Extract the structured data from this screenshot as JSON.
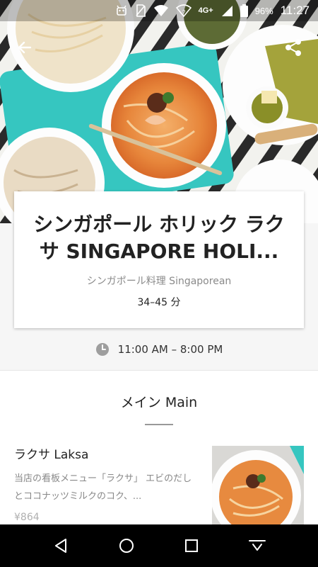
{
  "status_bar": {
    "network": "4G+",
    "battery": "96%",
    "time": "11:27"
  },
  "restaurant": {
    "title": "シンガポール ホリック ラクサ SINGAPORE HOLI...",
    "cuisine": "シンガポール料理 Singaporean",
    "delivery_time": "34–45 分",
    "hours": "11:00 AM – 8:00 PM"
  },
  "menu": {
    "section_title": "メイン Main",
    "items": [
      {
        "name": "ラクサ Laksa",
        "description": "当店の看板メニュー「ラクサ」 エビのだしとココナッツミルクのコク、...",
        "price": "¥864"
      }
    ]
  },
  "icons": [
    "back-arrow-icon",
    "share-icon",
    "clock-icon",
    "nav-back-icon",
    "nav-home-icon",
    "nav-recents-icon",
    "nav-keyboard-icon"
  ],
  "colors": {
    "accent_teal": "#36c6c0",
    "broth_orange": "#e5873e"
  }
}
